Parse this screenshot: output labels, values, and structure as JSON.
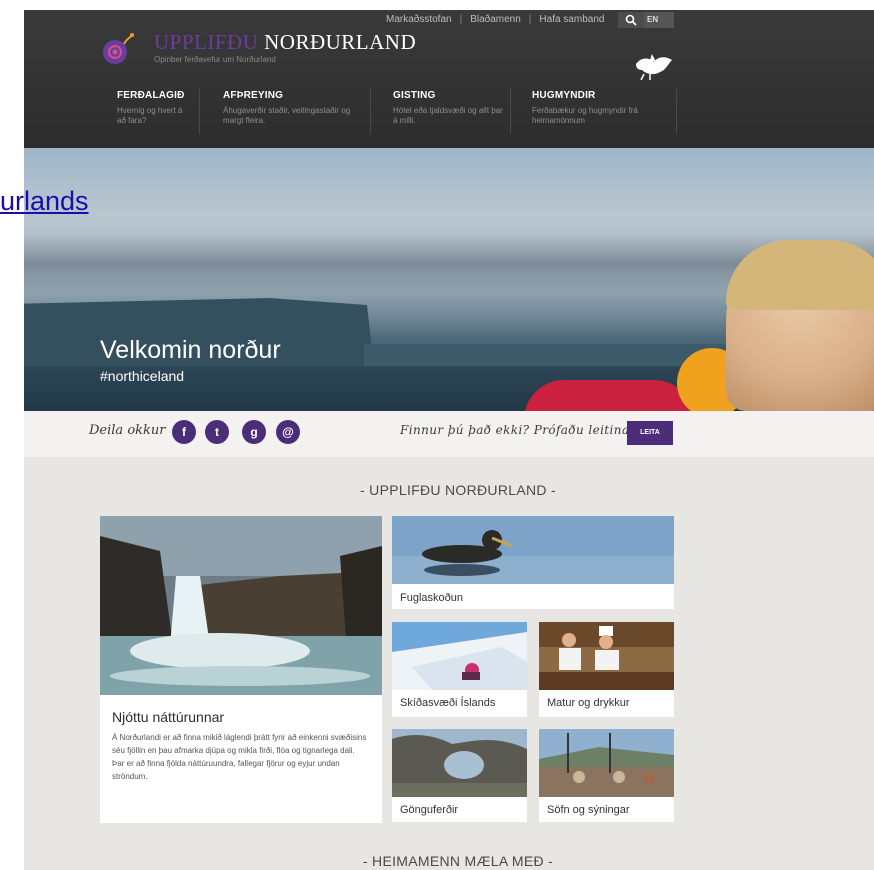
{
  "overlay_link": "urlands",
  "header": {
    "top_links": [
      "Markaðsstofan",
      "Blaðamenn",
      "Hafa samband"
    ],
    "lang": "EN",
    "logo_part1": "UPPLIFÐU",
    "logo_part2": "NORÐURLAND",
    "logo_sub": "Opinber ferðavefur um Norðurland",
    "nav": [
      {
        "title": "FERÐALAGIÐ",
        "desc": "Hvernig og hvert á að fara?"
      },
      {
        "title": "AFÞREYING",
        "desc": "Áhugaverðir staðir, veitingastaðir og margt fleira."
      },
      {
        "title": "GISTING",
        "desc": "Hótel eða tjaldsvæði og allt þar á milli."
      },
      {
        "title": "HUGMYNDIR",
        "desc": "Ferðabækur og hugmyndir frá heimamönnum"
      }
    ]
  },
  "hero": {
    "title": "Velkomin norður",
    "tag": "#northiceland"
  },
  "share": {
    "label": "Deila okkur",
    "icons": [
      "f",
      "t",
      "g",
      "@"
    ],
    "prompt": "Finnur þú það ekki? Prófaðu leitina :)",
    "button": "LEITA"
  },
  "section1": "- UPPLIFÐU NORÐURLAND -",
  "section2": "- HEIMAMENN MÆLA MEÐ -",
  "cards": {
    "big_title": "Njóttu náttúrunnar",
    "big_text": "Á Norðurlandi er að finna mikið láglendi þrátt fyrir að einkenni svæðisins séu fjöllin en þau afmarka djúpa og mikla firði, flóa og tignarlega dali. Þar er að finna fjölda náttúruundra, fallegar fjörur og eyjur undan ströndum.",
    "fugl": "Fuglaskoðun",
    "ski": "Skíðasvæði Íslands",
    "matur": "Matur og drykkur",
    "ganga": "Gönguferðir",
    "sofn": "Söfn og sýningar"
  },
  "colors": {
    "brand_purple": "#4b2d7a",
    "header_dark": "#333334"
  }
}
